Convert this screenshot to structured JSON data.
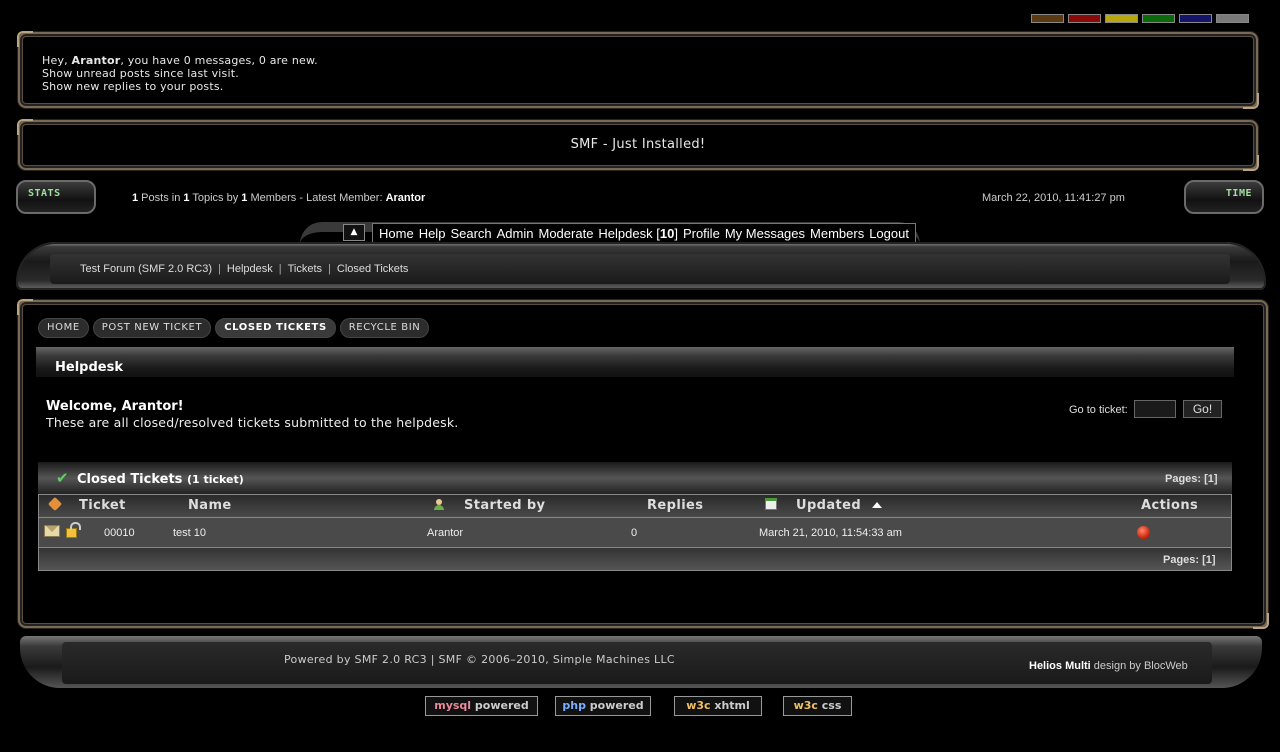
{
  "theme_swatches": [
    "#5a3a12",
    "#8a0a0a",
    "#b8a810",
    "#0a6a0a",
    "#14146a",
    "#7a7a7a"
  ],
  "user_panel": {
    "greeting_pre": "Hey, ",
    "username": "Arantor",
    "greeting_post": ", you have 0 messages, 0 are new.",
    "unread_link": "Show unread posts since last visit.",
    "replies_link": "Show new replies to your posts."
  },
  "forum_title": "SMF - Just Installed!",
  "stats": {
    "stats_label": "STATS",
    "time_label": "TIME",
    "posts": "1",
    "posts_in": " Posts in ",
    "topics": "1",
    "topics_by": " Topics by ",
    "members": "1",
    "members_latest": " Members - Latest Member: ",
    "latest_member": "Arantor",
    "datetime": "March 22, 2010, 11:41:27 pm"
  },
  "menu": {
    "items": [
      "Home",
      "Help",
      "Search",
      "Admin",
      "Moderate",
      "Helpdesk"
    ],
    "helpdesk_count": "10",
    "items_after": [
      "Profile",
      "My Messages",
      "Members",
      "Logout"
    ]
  },
  "breadcrumb": [
    "Test Forum (SMF 2.0 RC3)",
    "Helpdesk",
    "Tickets",
    "Closed Tickets"
  ],
  "tabs": [
    "HOME",
    "POST NEW TICKET",
    "CLOSED TICKETS",
    "RECYCLE BIN"
  ],
  "active_tab": "CLOSED TICKETS",
  "helpdesk": {
    "heading": "Helpdesk",
    "welcome": "Welcome, Arantor!",
    "description": "These are all closed/resolved tickets submitted to the helpdesk.",
    "goto_label": "Go to ticket:",
    "goto_button": "Go!"
  },
  "tickets": {
    "title": "Closed Tickets",
    "count_label": "(1 ticket)",
    "pages": "Pages: [1]",
    "columns": {
      "ticket": "Ticket",
      "name": "Name",
      "started_by": "Started by",
      "replies": "Replies",
      "updated": "Updated",
      "actions": "Actions"
    },
    "rows": [
      {
        "id": "00010",
        "name": "test 10",
        "started_by": "Arantor",
        "replies": "0",
        "updated": "March 21, 2010, 11:54:33 am"
      }
    ]
  },
  "footer": {
    "powered": "Powered by SMF 2.0 RC3 | SMF © 2006–2010, Simple Machines LLC",
    "design_name": "Helios Multi",
    "design_by": " design by ",
    "design_author": "BlocWeb"
  },
  "badges": [
    {
      "a": "mysql",
      "b": " powered",
      "a_color": "#e88a9a"
    },
    {
      "a": "php",
      "b": " powered",
      "a_color": "#7ab0ff"
    },
    {
      "a": "w3c",
      "b": " xhtml",
      "a_color": "#f0c060"
    },
    {
      "a": "w3c",
      "b": " css",
      "a_color": "#f0c060"
    }
  ]
}
